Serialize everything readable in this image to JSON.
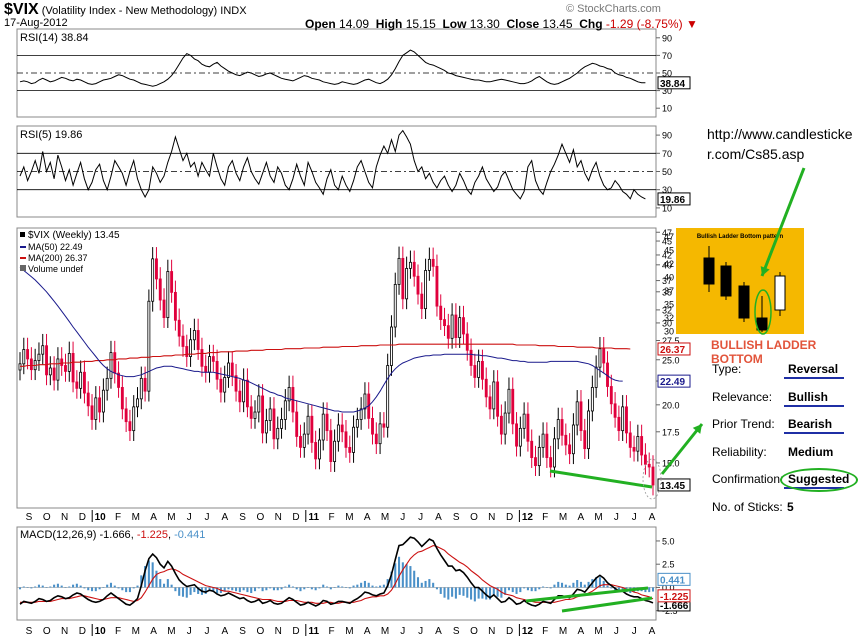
{
  "header": {
    "symbol": "$VIX",
    "name": "(Volatility Index - New Methodology)",
    "exchange": "INDX",
    "date": "17-Aug-2012",
    "open_label": "Open",
    "open": "14.09",
    "high_label": "High",
    "high": "15.15",
    "low_label": "Low",
    "low": "13.30",
    "close_label": "Close",
    "close": "13.45",
    "chg_label": "Chg",
    "chg": "-1.29 (-8.75%)",
    "watermark": "© StockCharts.com"
  },
  "annotation": {
    "url": "http://www.candlesticker.com/Cs85.asp",
    "pattern_title": "BULLISH LADDER BOTTOM",
    "inset_title": "Bullish Ladder Bottom pattern",
    "rows": [
      {
        "label": "Type:",
        "value": "Reversal",
        "underline": true
      },
      {
        "label": "Relevance:",
        "value": "Bullish",
        "underline": true
      },
      {
        "label": "Prior Trend:",
        "value": "Bearish",
        "underline": true
      },
      {
        "label": "Reliability:",
        "value": "Medium",
        "underline": false
      },
      {
        "label": "Confirmation:",
        "value": "Suggested",
        "underline": true
      },
      {
        "label": "No. of Sticks:",
        "value": "5",
        "underline": false
      }
    ]
  },
  "colors": {
    "up": "#000000",
    "down": "#e0003c",
    "ma50": "#1a1a8c",
    "ma200": "#cc1111",
    "hist": "#4a90c8",
    "arrow": "#22b022",
    "accent": "#e2543b",
    "inset_bg": "#f5b800"
  },
  "chart_data": [
    {
      "type": "line",
      "title": "RSI(14) 38.84",
      "ylim": [
        0,
        100
      ],
      "yticks": [
        10,
        30,
        50,
        70,
        90
      ],
      "reference_lines": [
        30,
        50,
        70
      ],
      "last_label": "38.84",
      "values": [
        40,
        41,
        40,
        38,
        39,
        42,
        44,
        42,
        40,
        41,
        43,
        45,
        44,
        42,
        41,
        43,
        42,
        40,
        38,
        37,
        38,
        40,
        42,
        43,
        44,
        46,
        48,
        47,
        45,
        43,
        42,
        40,
        38,
        37,
        36,
        35,
        36,
        38,
        40,
        43,
        47,
        53,
        60,
        67,
        72,
        70,
        66,
        64,
        60,
        58,
        57,
        60,
        62,
        58,
        55,
        52,
        50,
        48,
        47,
        49,
        51,
        50,
        48,
        46,
        47,
        49,
        50,
        48,
        46,
        44,
        43,
        42,
        41,
        43,
        45,
        47,
        46,
        44,
        43,
        42,
        40,
        39,
        38,
        37,
        38,
        40,
        39,
        38,
        37,
        38,
        40,
        42,
        43,
        41,
        39,
        38,
        40,
        43,
        48,
        55,
        63,
        70,
        73,
        76,
        74,
        70,
        66,
        62,
        60,
        59,
        57,
        55,
        53,
        50,
        49,
        47,
        46,
        45,
        44,
        43,
        42,
        42,
        41,
        40,
        40,
        41,
        42,
        43,
        42,
        41,
        40,
        39,
        38,
        38,
        39,
        41,
        44,
        46,
        43,
        40,
        38,
        37,
        38,
        40,
        42,
        44,
        47,
        50,
        54,
        57,
        59,
        61,
        60,
        58,
        57,
        55,
        54,
        50,
        48,
        47,
        45,
        44,
        42,
        40,
        39,
        38.84
      ]
    },
    {
      "type": "line",
      "title": "RSI(5) 19.86",
      "ylim": [
        0,
        100
      ],
      "yticks": [
        10,
        30,
        50,
        70,
        90
      ],
      "reference_lines": [
        30,
        50,
        70
      ],
      "last_label": "19.86",
      "values": [
        45,
        55,
        40,
        50,
        62,
        48,
        72,
        50,
        60,
        42,
        68,
        55,
        40,
        52,
        35,
        48,
        60,
        42,
        30,
        38,
        52,
        58,
        40,
        30,
        45,
        62,
        55,
        48,
        35,
        50,
        62,
        42,
        30,
        22,
        30,
        55,
        48,
        38,
        45,
        60,
        72,
        88,
        75,
        62,
        70,
        55,
        60,
        45,
        60,
        52,
        45,
        70,
        55,
        42,
        35,
        55,
        62,
        48,
        40,
        55,
        65,
        50,
        42,
        36,
        48,
        60,
        45,
        38,
        55,
        48,
        35,
        30,
        42,
        58,
        45,
        35,
        60,
        50,
        38,
        32,
        25,
        42,
        52,
        35,
        30,
        45,
        35,
        28,
        40,
        55,
        62,
        50,
        38,
        32,
        55,
        68,
        78,
        70,
        85,
        72,
        90,
        95,
        88,
        80,
        62,
        50,
        55,
        42,
        48,
        38,
        32,
        40,
        45,
        35,
        28,
        35,
        48,
        40,
        30,
        25,
        38,
        45,
        55,
        42,
        35,
        28,
        33,
        45,
        50,
        40,
        30,
        25,
        20,
        28,
        55,
        62,
        40,
        30,
        25,
        38,
        50,
        58,
        68,
        80,
        70,
        60,
        74,
        55,
        62,
        48,
        40,
        52,
        60,
        45,
        35,
        30,
        32,
        40,
        35,
        28,
        25,
        20,
        30,
        25,
        22,
        19.86
      ]
    },
    {
      "type": "candlestick",
      "title": "$VIX (Weekly) 13.45",
      "ylim": [
        12,
        48
      ],
      "yticks": [
        15.0,
        17.5,
        20.0,
        22.5,
        25.0,
        27.5,
        30,
        32,
        35,
        37,
        40,
        42,
        45,
        47
      ],
      "last_label": "13.45",
      "series": [
        {
          "name": "MA(50) 22.49",
          "last": "22.49"
        },
        {
          "name": "MA(200) 26.37",
          "last": "26.37"
        },
        {
          "name": "Volume undef"
        }
      ],
      "closes": [
        24.5,
        26.3,
        25.1,
        23.8,
        24.9,
        25.7,
        26.8,
        23.2,
        24.0,
        22.6,
        25.1,
        24.3,
        23.6,
        25.8,
        22.4,
        21.7,
        23.5,
        21.2,
        19.9,
        18.6,
        20.7,
        19.3,
        21.5,
        22.8,
        25.9,
        23.4,
        21.8,
        19.6,
        18.4,
        17.6,
        19.8,
        20.6,
        22.8,
        21.4,
        33.4,
        41.2,
        37.3,
        33.6,
        30.8,
        38.7,
        34.9,
        30.4,
        28.1,
        26.7,
        25.4,
        27.6,
        28.9,
        26.3,
        24.2,
        23.5,
        25.4,
        24.8,
        22.7,
        21.3,
        22.9,
        24.6,
        23.1,
        21.4,
        20.3,
        22.6,
        19.8,
        18.7,
        19.3,
        20.9,
        17.4,
        18.5,
        19.6,
        16.9,
        17.8,
        18.6,
        20.4,
        21.8,
        19.3,
        17.1,
        16.2,
        17.3,
        18.9,
        16.6,
        15.3,
        16.8,
        19.1,
        17.6,
        15.1,
        16.7,
        18.1,
        17.5,
        16.2,
        15.8,
        17.9,
        18.6,
        19.6,
        21.1,
        18.7,
        17.3,
        16.5,
        18.2,
        17.9,
        24.3,
        29.4,
        36.3,
        41.3,
        33.8,
        39.3,
        40.5,
        37.8,
        34.6,
        32.2,
        38.9,
        41.1,
        39.7,
        32.6,
        30.5,
        29.6,
        27.8,
        31.2,
        27.9,
        30.8,
        28.4,
        26.2,
        24.3,
        22.9,
        24.8,
        22.7,
        20.8,
        19.6,
        22.4,
        18.9,
        17.3,
        19.2,
        21.6,
        18.2,
        16.3,
        17.8,
        19.1,
        16.7,
        15.4,
        14.8,
        16.2,
        17.3,
        15.4,
        14.7,
        16.9,
        18.6,
        17.2,
        16.4,
        15.7,
        18.1,
        20.3,
        17.6,
        16.1,
        19.4,
        21.8,
        24.1,
        26.4,
        24.6,
        21.9,
        20.1,
        18.8,
        17.6,
        19.8,
        17.4,
        16.2,
        15.9,
        17.1,
        15.6,
        14.9,
        14.7,
        13.45
      ],
      "ma50": [
        39.5,
        38.9,
        38.3,
        37.7,
        37.1,
        36.4,
        35.7,
        35.0,
        34.2,
        33.4,
        32.6,
        31.8,
        31.0,
        30.2,
        29.4,
        28.7,
        28.0,
        27.3,
        26.6,
        26.0,
        25.4,
        24.8,
        24.3,
        23.9,
        23.6,
        23.4,
        23.2,
        23.1,
        23.0,
        23.0,
        23.0,
        23.1,
        23.2,
        23.4,
        23.6,
        23.8,
        24.0,
        24.1,
        24.2,
        24.2,
        24.2,
        24.1,
        24.0,
        23.9,
        23.8,
        23.7,
        23.6,
        23.6,
        23.5,
        23.5,
        23.5,
        23.5,
        23.4,
        23.3,
        23.2,
        23.1,
        23.0,
        22.9,
        22.8,
        22.6,
        22.5,
        22.3,
        22.1,
        21.9,
        21.7,
        21.5,
        21.3,
        21.2,
        21.0,
        20.9,
        20.7,
        20.6,
        20.5,
        20.4,
        20.3,
        20.2,
        20.1,
        20.0,
        19.9,
        19.8,
        19.7,
        19.6,
        19.5,
        19.4,
        19.4,
        19.3,
        19.3,
        19.3,
        19.3,
        19.4,
        19.5,
        19.7,
        19.9,
        20.3,
        20.8,
        21.4,
        22.1,
        22.8,
        23.4,
        23.9,
        24.3,
        24.6,
        24.8,
        25.0,
        25.2,
        25.3,
        25.4,
        25.5,
        25.5,
        25.6,
        25.6,
        25.6,
        25.7,
        25.7,
        25.7,
        25.7,
        25.7,
        25.7,
        25.7,
        25.7,
        25.6,
        25.6,
        25.5,
        25.5,
        25.4,
        25.3,
        25.2,
        25.2,
        25.1,
        25.0,
        24.9,
        24.9,
        24.8,
        24.8,
        24.7,
        24.7,
        24.7,
        24.7,
        24.7,
        24.7,
        24.8,
        24.8,
        24.8,
        24.8,
        24.8,
        24.8,
        24.8,
        24.8,
        24.7,
        24.6,
        24.5,
        24.3,
        24.0,
        23.7,
        23.4,
        23.1,
        22.8,
        22.6,
        22.5,
        22.49
      ],
      "ma200": [
        24.2,
        24.2,
        24.3,
        24.3,
        24.3,
        24.4,
        24.4,
        24.4,
        24.5,
        24.5,
        24.5,
        24.6,
        24.6,
        24.6,
        24.7,
        24.7,
        24.7,
        24.8,
        24.8,
        24.8,
        24.9,
        24.9,
        24.9,
        25.0,
        25.0,
        25.0,
        25.1,
        25.1,
        25.1,
        25.2,
        25.2,
        25.2,
        25.3,
        25.3,
        25.3,
        25.4,
        25.4,
        25.4,
        25.5,
        25.5,
        25.5,
        25.6,
        25.6,
        25.6,
        25.7,
        25.7,
        25.7,
        25.8,
        25.8,
        25.8,
        25.9,
        25.9,
        25.9,
        26.0,
        26.0,
        26.0,
        26.0,
        26.1,
        26.1,
        26.1,
        26.1,
        26.2,
        26.2,
        26.2,
        26.2,
        26.3,
        26.3,
        26.3,
        26.3,
        26.3,
        26.4,
        26.4,
        26.4,
        26.4,
        26.4,
        26.5,
        26.5,
        26.5,
        26.5,
        26.5,
        26.6,
        26.6,
        26.6,
        26.6,
        26.6,
        26.7,
        26.7,
        26.7,
        26.7,
        26.7,
        26.8,
        26.8,
        26.8,
        26.8,
        26.8,
        26.9,
        26.9,
        26.9,
        26.9,
        26.9,
        27.0,
        27.0,
        27.0,
        27.0,
        27.0,
        27.0,
        27.0,
        27.0,
        27.0,
        27.0,
        27.0,
        27.0,
        27.0,
        27.0,
        27.0,
        27.0,
        27.0,
        27.0,
        27.0,
        27.0,
        27.0,
        27.0,
        27.0,
        27.0,
        27.0,
        27.0,
        27.0,
        27.0,
        27.0,
        27.0,
        27.0,
        26.9,
        26.9,
        26.9,
        26.9,
        26.9,
        26.9,
        26.8,
        26.8,
        26.8,
        26.8,
        26.8,
        26.7,
        26.7,
        26.7,
        26.7,
        26.7,
        26.6,
        26.6,
        26.6,
        26.6,
        26.6,
        26.5,
        26.5,
        26.5,
        26.5,
        26.5,
        26.4,
        26.4,
        26.4,
        26.4,
        26.37
      ]
    },
    {
      "type": "line",
      "title": "MACD(12,26,9)",
      "series": [
        {
          "name": "-1.666",
          "last": "-1.666"
        },
        {
          "name": "-1.225",
          "last": "-1.225"
        },
        {
          "name": "-0.441",
          "last": "-0.441"
        }
      ],
      "ylim": [
        -3.5,
        6.5
      ],
      "yticks": [
        -2.5,
        0.0,
        2.5,
        5.0
      ],
      "last_labels": [
        "0.441",
        "-1.225",
        "-1.666"
      ],
      "macd": [
        -1.8,
        -1.5,
        -1.6,
        -1.7,
        -1.5,
        -1.2,
        -1.3,
        -1.5,
        -1.4,
        -1.1,
        -0.9,
        -1.0,
        -1.2,
        -1.1,
        -0.8,
        -0.6,
        -0.7,
        -1.0,
        -1.3,
        -1.5,
        -1.6,
        -1.5,
        -1.3,
        -0.9,
        -0.6,
        -0.9,
        -1.2,
        -1.5,
        -1.8,
        -1.9,
        -1.6,
        -1.2,
        0.2,
        1.8,
        3.1,
        3.6,
        3.2,
        2.5,
        2.1,
        2.8,
        2.3,
        1.5,
        0.8,
        0.4,
        0.1,
        0.2,
        0.3,
        -0.1,
        -0.4,
        -0.5,
        -0.3,
        -0.4,
        -0.7,
        -0.9,
        -0.8,
        -0.6,
        -0.8,
        -1.0,
        -1.2,
        -1.1,
        -1.4,
        -1.6,
        -1.5,
        -1.3,
        -1.7,
        -1.6,
        -1.4,
        -1.7,
        -1.8,
        -1.7,
        -1.4,
        -1.1,
        -1.3,
        -1.6,
        -1.9,
        -1.8,
        -1.6,
        -1.8,
        -2.0,
        -1.8,
        -1.4,
        -1.5,
        -1.8,
        -1.7,
        -1.5,
        -1.5,
        -1.6,
        -1.7,
        -1.4,
        -1.2,
        -0.9,
        -0.5,
        -0.6,
        -0.8,
        -0.9,
        -0.7,
        -0.6,
        0.2,
        1.4,
        3.0,
        4.5,
        4.6,
        5.0,
        5.4,
        5.3,
        4.9,
        4.4,
        4.8,
        5.2,
        5.0,
        4.2,
        3.5,
        2.9,
        2.3,
        2.3,
        1.8,
        1.9,
        1.6,
        1.1,
        0.5,
        0.0,
        0.0,
        -0.4,
        -0.8,
        -1.1,
        -0.8,
        -1.2,
        -1.6,
        -1.5,
        -1.1,
        -1.4,
        -1.8,
        -1.7,
        -1.4,
        -1.7,
        -1.9,
        -2.0,
        -1.8,
        -1.5,
        -1.6,
        -1.7,
        -1.3,
        -0.9,
        -0.9,
        -1.0,
        -1.1,
        -0.7,
        -0.2,
        -0.3,
        -0.5,
        0.0,
        0.5,
        1.0,
        1.3,
        1.0,
        0.5,
        0.2,
        -0.1,
        -0.4,
        -0.4,
        -0.7,
        -0.9,
        -1.0,
        -1.0,
        -1.2,
        -1.4,
        -1.5,
        -1.666
      ],
      "signal": [
        -1.6,
        -1.6,
        -1.6,
        -1.6,
        -1.6,
        -1.5,
        -1.5,
        -1.5,
        -1.5,
        -1.4,
        -1.3,
        -1.2,
        -1.2,
        -1.2,
        -1.1,
        -1.0,
        -0.9,
        -0.9,
        -1.0,
        -1.1,
        -1.2,
        -1.3,
        -1.3,
        -1.2,
        -1.1,
        -1.1,
        -1.1,
        -1.2,
        -1.3,
        -1.4,
        -1.5,
        -1.4,
        -1.1,
        -0.5,
        0.2,
        0.9,
        1.4,
        1.6,
        1.7,
        1.9,
        2.0,
        1.9,
        1.7,
        1.4,
        1.2,
        1.0,
        0.8,
        0.6,
        0.4,
        0.2,
        0.1,
        0.0,
        -0.1,
        -0.3,
        -0.4,
        -0.4,
        -0.5,
        -0.6,
        -0.7,
        -0.8,
        -0.9,
        -1.0,
        -1.1,
        -1.2,
        -1.3,
        -1.3,
        -1.3,
        -1.4,
        -1.5,
        -1.5,
        -1.5,
        -1.4,
        -1.4,
        -1.4,
        -1.5,
        -1.6,
        -1.6,
        -1.6,
        -1.7,
        -1.7,
        -1.7,
        -1.6,
        -1.6,
        -1.7,
        -1.7,
        -1.6,
        -1.6,
        -1.6,
        -1.6,
        -1.5,
        -1.4,
        -1.2,
        -1.1,
        -1.0,
        -1.0,
        -0.9,
        -0.9,
        -0.7,
        -0.3,
        0.4,
        1.2,
        1.9,
        2.5,
        3.1,
        3.5,
        3.8,
        3.9,
        4.1,
        4.3,
        4.5,
        4.4,
        4.2,
        4.0,
        3.6,
        3.3,
        3.0,
        2.7,
        2.5,
        2.2,
        1.8,
        1.5,
        1.2,
        0.8,
        0.5,
        0.2,
        0.0,
        -0.2,
        -0.5,
        -0.7,
        -0.8,
        -0.9,
        -1.1,
        -1.2,
        -1.3,
        -1.4,
        -1.5,
        -1.6,
        -1.6,
        -1.6,
        -1.6,
        -1.6,
        -1.6,
        -1.5,
        -1.4,
        -1.3,
        -1.3,
        -1.2,
        -1.0,
        -0.9,
        -0.8,
        -0.6,
        -0.4,
        -0.1,
        0.2,
        0.3,
        0.3,
        0.3,
        0.2,
        0.1,
        0.0,
        -0.2,
        -0.3,
        -0.5,
        -0.6,
        -0.8,
        -0.9,
        -1.0,
        -1.225
      ]
    }
  ],
  "xaxis": {
    "labels": [
      "S",
      "O",
      "N",
      "D",
      "10",
      "F",
      "M",
      "A",
      "M",
      "J",
      "J",
      "A",
      "S",
      "O",
      "N",
      "D",
      "11",
      "F",
      "M",
      "A",
      "M",
      "J",
      "J",
      "A",
      "S",
      "O",
      "N",
      "D",
      "12",
      "F",
      "M",
      "A",
      "M",
      "J",
      "J",
      "A"
    ],
    "bold": [
      "10",
      "11",
      "12"
    ]
  }
}
